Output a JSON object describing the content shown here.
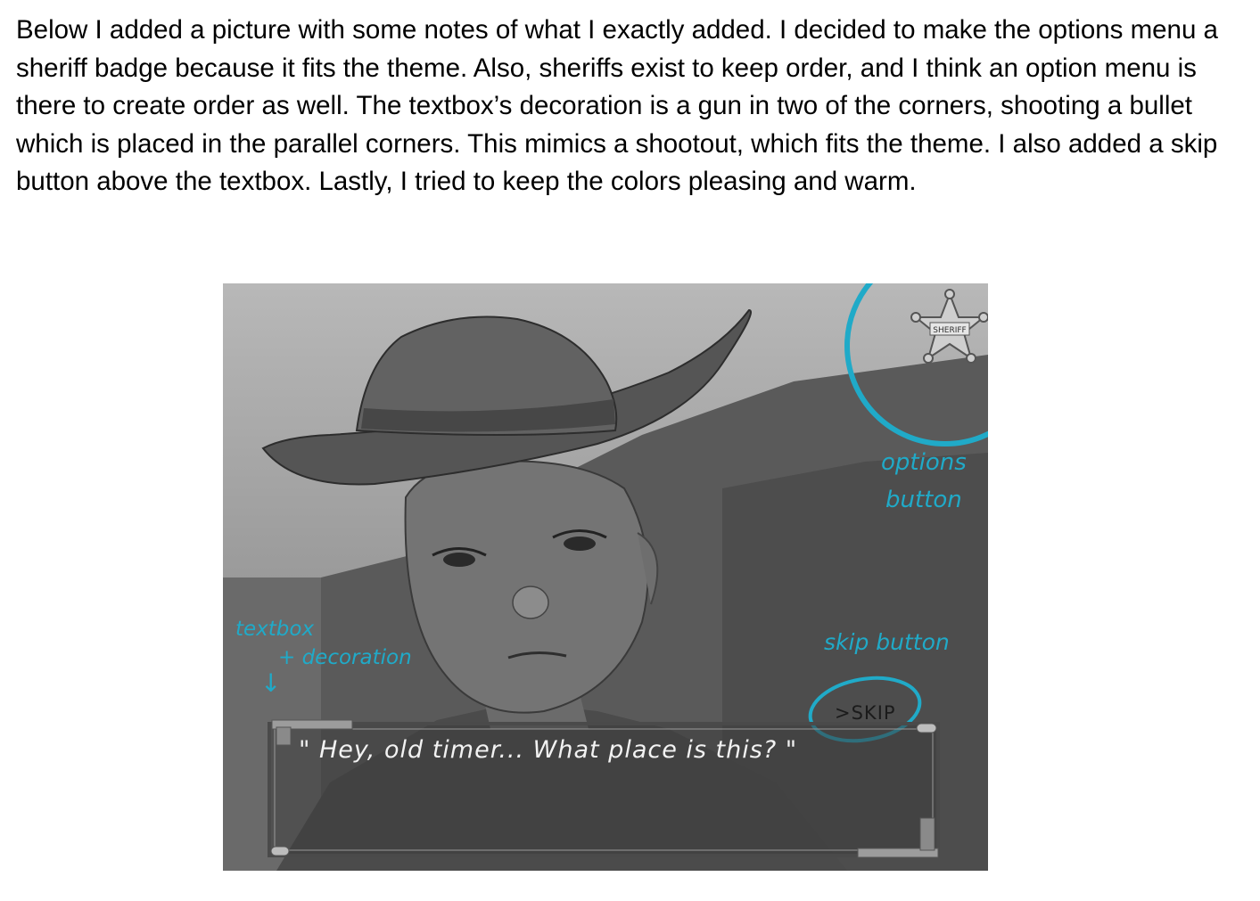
{
  "paragraph": "Below I added a picture with some notes of what I exactly added. I decided to make the options menu a sheriff badge because it fits the theme. Also, sheriffs exist to keep order, and I think an option menu is there to create order as well. The textbox’s decoration is a gun in two of the corners, shooting a bullet which is placed in the parallel corners. This mimics a shootout, which fits the theme. I also added a skip button above the textbox. Lastly, I tried to keep the colors pleasing and warm.",
  "figure": {
    "badge_text": "SHERIFF",
    "annotations": {
      "options_line1": "options",
      "options_line2": "button",
      "textbox_line1": "textbox",
      "textbox_line2": "+ decoration",
      "arrow": "↓",
      "skip_note": "skip button"
    },
    "skip_label": ">SKIP",
    "dialogue": "\" Hey, old timer... What place is this? \""
  },
  "colors": {
    "annotation": "#20aac8",
    "textbox_border": "#4a4a4a"
  }
}
